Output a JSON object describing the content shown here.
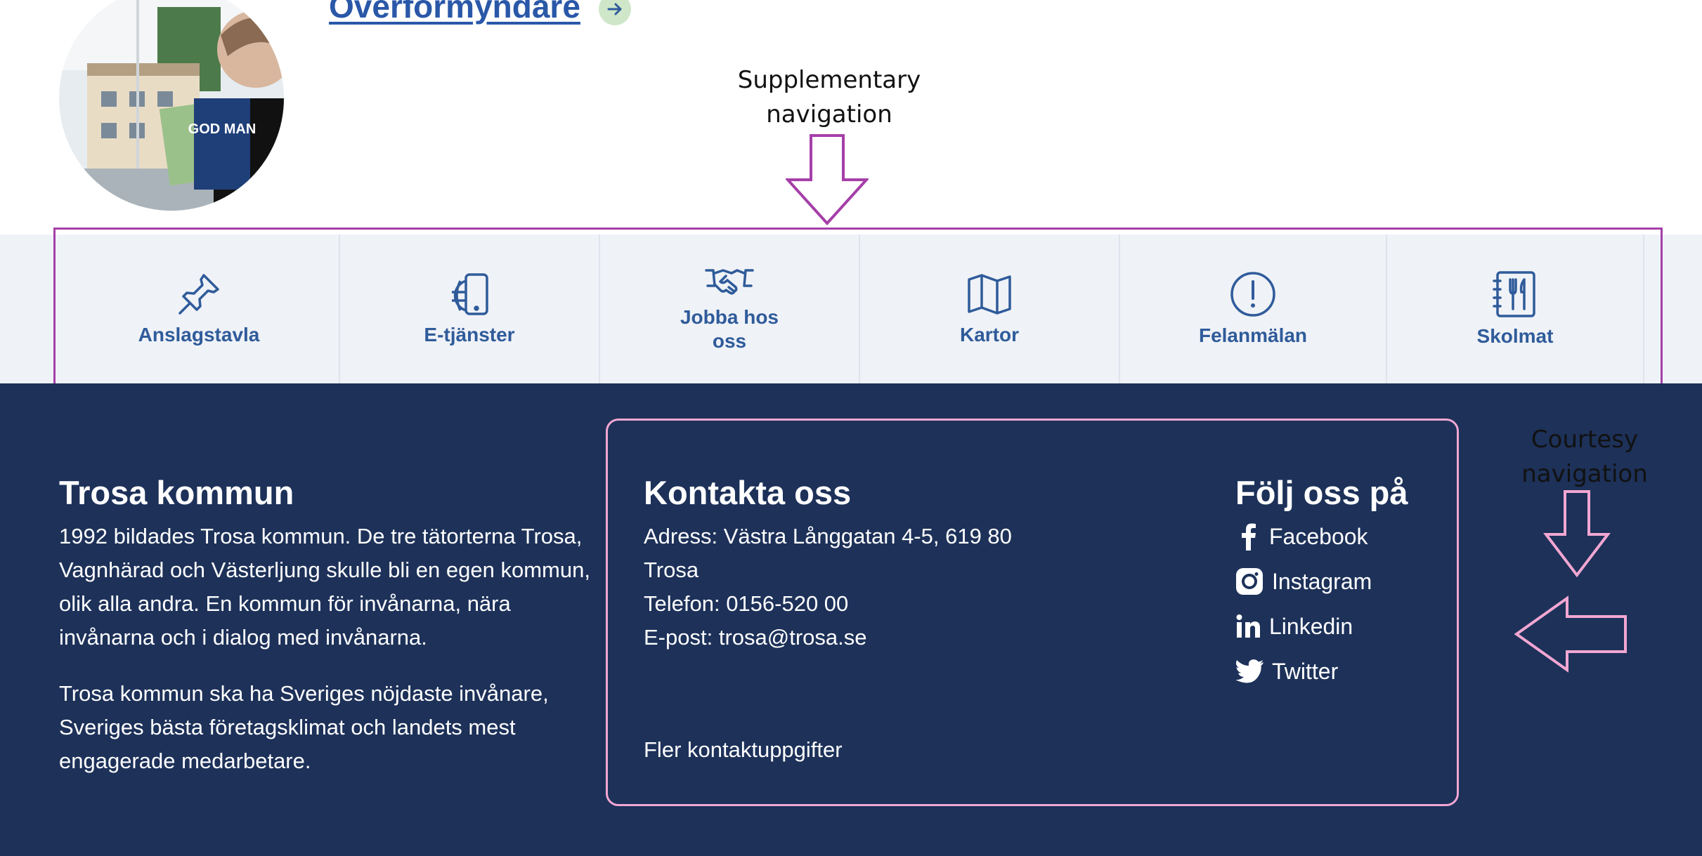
{
  "hero": {
    "link_text": "Överförmyndare",
    "image_book_text": "GOD MAN"
  },
  "annotations": {
    "supplementary_line1": "Supplementary",
    "supplementary_line2": "navigation",
    "courtesy_line1": "Courtesy",
    "courtesy_line2": "navigation"
  },
  "supplementary_nav": {
    "items": [
      {
        "label": "Anslagstavla",
        "icon": "pushpin-icon"
      },
      {
        "label": "E-tjänster",
        "icon": "globe-tablet-icon"
      },
      {
        "label": "Jobba hos oss",
        "icon": "handshake-icon"
      },
      {
        "label": "Kartor",
        "icon": "map-icon"
      },
      {
        "label": "Felanmälan",
        "icon": "exclamation-circle-icon"
      },
      {
        "label": "Skolmat",
        "icon": "menu-cutlery-icon"
      }
    ]
  },
  "footer": {
    "about": {
      "title": "Trosa kommun",
      "paragraph1": "1992 bildades Trosa kommun. De tre tätorterna Trosa, Vagnhärad och Västerljung skulle bli en egen kommun, olik alla andra. En kommun för invånarna, nära invånarna och i dialog med invånarna.",
      "paragraph2": "Trosa kommun ska ha Sveriges nöjdaste invånare, Sveriges bästa företagsklimat och landets mest engagerade medarbetare."
    },
    "contact": {
      "title": "Kontakta oss",
      "address": "Adress: Västra Långgatan 4-5, 619 80 Trosa",
      "phone": "Telefon: 0156-520 00",
      "email_label": "E-post: ",
      "email_link": "trosa@trosa.se",
      "more_link": "Fler kontaktuppgifter"
    },
    "social": {
      "title": "Följ oss på",
      "links": [
        {
          "label": "Facebook",
          "icon": "facebook-icon"
        },
        {
          "label": "Instagram",
          "icon": "instagram-icon"
        },
        {
          "label": "Linkedin",
          "icon": "linkedin-icon"
        },
        {
          "label": "Twitter",
          "icon": "twitter-icon"
        }
      ]
    }
  },
  "colors": {
    "footer_bg": "#1d3159",
    "supp_bg": "#eff2f7",
    "nav_text": "#2f5b9a",
    "supp_annotation": "#a53fa8",
    "courtesy_annotation": "#f2a7d2"
  }
}
